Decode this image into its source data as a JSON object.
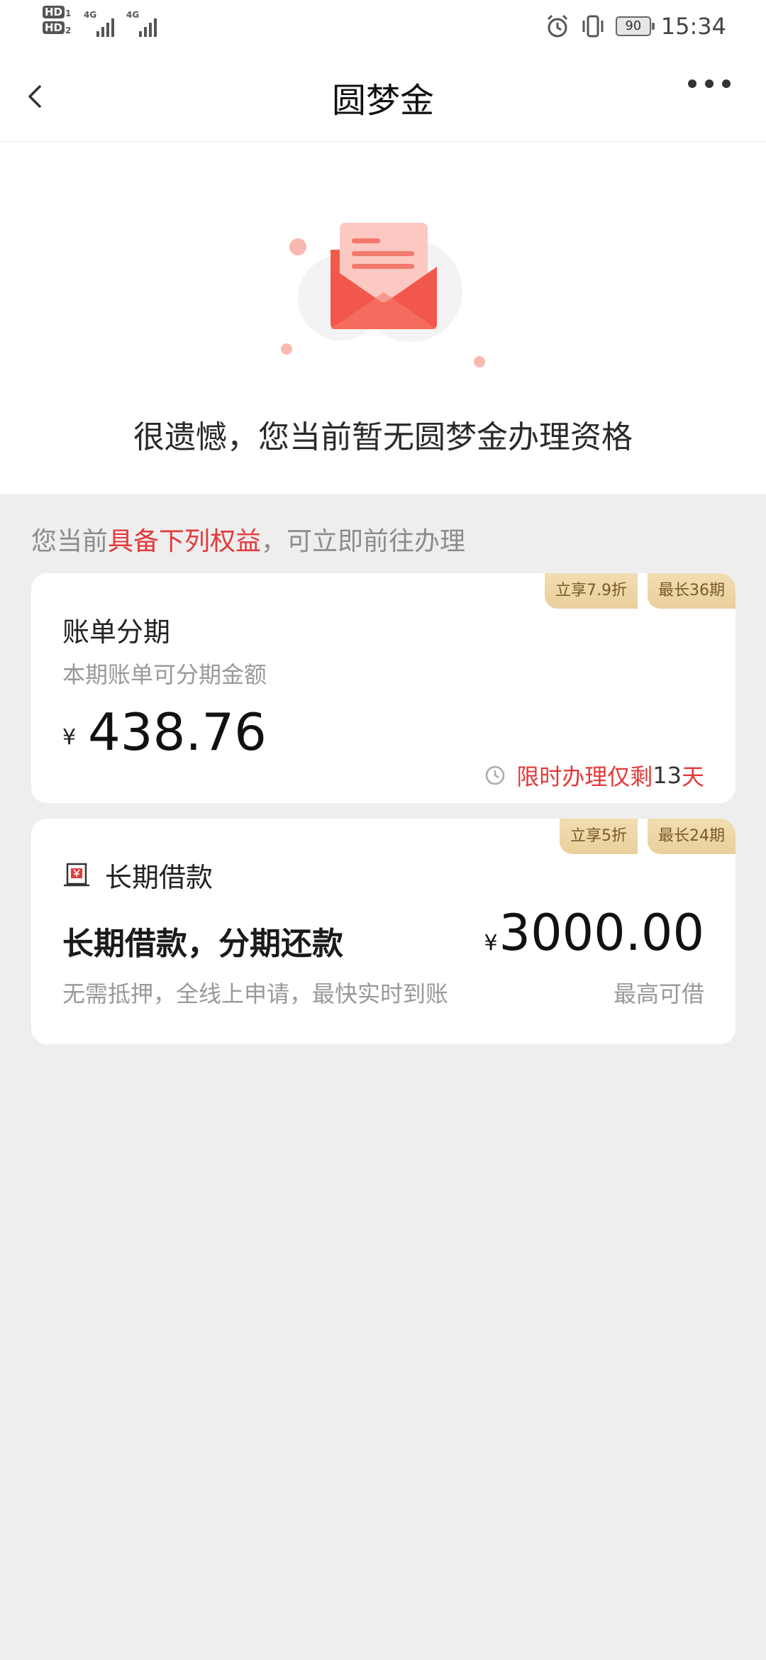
{
  "status_bar": {
    "hd_1": "HD",
    "hd_1_index": "1",
    "hd_2": "HD",
    "hd_2_index": "2",
    "network_1": "4G",
    "network_2": "4G",
    "battery": "90",
    "time": "15:34"
  },
  "nav": {
    "title": "圆梦金"
  },
  "hero": {
    "message": "很遗憾，您当前暂无圆梦金办理资格"
  },
  "section": {
    "heading_prefix": "您当前",
    "heading_highlight": "具备下列权益",
    "heading_suffix": "，可立即前往办理"
  },
  "cards": [
    {
      "tags": [
        "立享7.9折",
        "最长36期"
      ],
      "title": "账单分期",
      "subtitle": "本期账单可分期金额",
      "currency": "¥",
      "amount": "438.76",
      "limit_prefix": "限时办理仅剩",
      "limit_days": "13",
      "limit_suffix": "天"
    },
    {
      "tags": [
        "立享5折",
        "最长24期"
      ],
      "title": "长期借款",
      "headline": "长期借款，分期还款",
      "currency": "¥",
      "amount": "3000.00",
      "subtitle": "无需抵押，全线上申请，最快实时到账",
      "amount_label": "最高可借"
    }
  ],
  "colors": {
    "accent_red": "#e33a3a",
    "tag_gold": "#eed6a6",
    "page_bg": "#eeeeee"
  },
  "icons": {
    "back": "chevron-left-icon",
    "more": "more-dots-icon",
    "alarm": "alarm-icon",
    "vibrate": "vibrate-icon",
    "clock": "clock-icon",
    "loan": "loan-icon",
    "envelope": "envelope-illustration"
  }
}
